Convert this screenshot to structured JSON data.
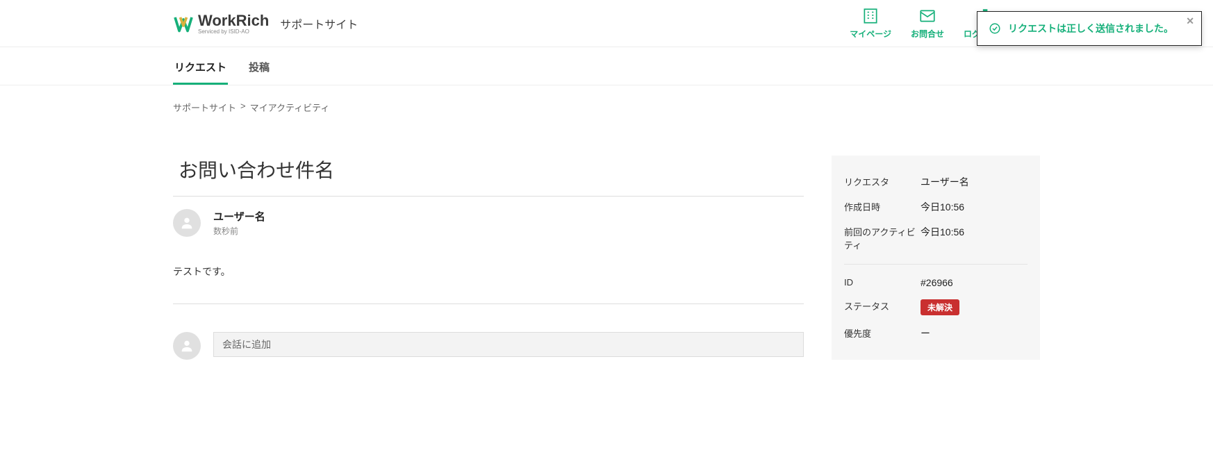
{
  "brand": {
    "name": "WorkRich",
    "tagline": "Serviced by ISID-AO",
    "site_title": "サポートサイト"
  },
  "colors": {
    "accent": "#16b07a",
    "status_red": "#c93030"
  },
  "nav": {
    "mypage": "マイページ",
    "contact": "お問合せ",
    "logout": "ログアウト"
  },
  "tabs": {
    "requests": "リクエスト",
    "posts": "投稿",
    "active": "requests"
  },
  "breadcrumb": {
    "home": "サポートサイト",
    "sep": ">",
    "current": "マイアクティビティ"
  },
  "request": {
    "title": "お問い合わせ件名",
    "comments": [
      {
        "user": "ユーザー名",
        "time": "数秒前",
        "body": "テストです。"
      }
    ],
    "reply_placeholder": "会話に追加"
  },
  "meta": {
    "requester_label": "リクエスタ",
    "requester": "ユーザー名",
    "created_label": "作成日時",
    "created": "今日10:56",
    "updated_label": "前回のアクティビティ",
    "updated": "今日10:56",
    "id_label": "ID",
    "id": "#26966",
    "status_label": "ステータス",
    "status": "未解決",
    "priority_label": "優先度",
    "priority": "ー"
  },
  "toast": {
    "message": "リクエストは正しく送信されました。"
  }
}
